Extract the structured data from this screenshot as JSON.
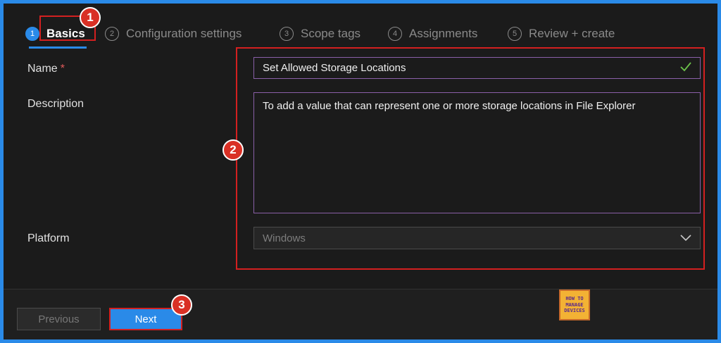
{
  "tabs": [
    {
      "step": "1",
      "label": "Basics",
      "active": true
    },
    {
      "step": "2",
      "label": "Configuration settings",
      "active": false
    },
    {
      "step": "3",
      "label": "Scope tags",
      "active": false
    },
    {
      "step": "4",
      "label": "Assignments",
      "active": false
    },
    {
      "step": "5",
      "label": "Review + create",
      "active": false
    }
  ],
  "form": {
    "name_label": "Name",
    "name_required": "*",
    "name_value": "Set Allowed Storage Locations",
    "description_label": "Description",
    "description_value": "To add a value that can represent one or more storage locations in File Explorer",
    "platform_label": "Platform",
    "platform_value": "Windows"
  },
  "footer": {
    "previous_label": "Previous",
    "next_label": "Next"
  },
  "callouts": [
    "1",
    "2",
    "3"
  ],
  "logo": {
    "line1": "HOW TO",
    "line2": "MANAGE",
    "line3": "DEVICES"
  },
  "colors": {
    "accent": "#2a8ae8",
    "callout": "#d32020",
    "valid": "#6cc24a"
  },
  "icons": {
    "valid": "checkmark-icon",
    "dropdown": "chevron-down-icon"
  }
}
